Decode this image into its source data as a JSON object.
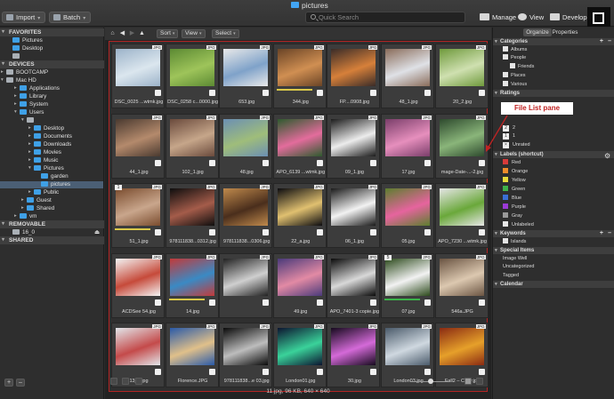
{
  "window": {
    "title": "pictures"
  },
  "toolbar": {
    "import_label": "Import",
    "batch_label": "Batch",
    "search_placeholder": "Quick Search",
    "modes": [
      "Manage",
      "View",
      "Develop"
    ]
  },
  "left_panel": {
    "favorites_header": "FAVORITES",
    "favorites": [
      "Pictures",
      "Desktop"
    ],
    "devices_header": "DEVICES",
    "devices": [
      "BOOTCAMP",
      "Mac HD"
    ],
    "mac_hd_children": [
      "Applications",
      "Library",
      "System",
      "Users"
    ],
    "user_children": [
      "Desktop",
      "Documents",
      "Downloads",
      "Movies",
      "Music",
      "Pictures"
    ],
    "pictures_children": [
      "garden",
      "pictures"
    ],
    "after_pictures": [
      "Public",
      "Guest",
      "Shared",
      "vm"
    ],
    "removable_header": "REMOVABLE",
    "removable_item": "16_0",
    "shared_header": "SHARED"
  },
  "center": {
    "toolbar": {
      "sort_label": "Sort",
      "view_label": "View",
      "select_label": "Select"
    },
    "files": [
      {
        "name": "DSC_0025 ...wtmk.jpg",
        "type": "JPG"
      },
      {
        "name": "DSC_0258 c...0000.jpg",
        "type": "JPG"
      },
      {
        "name": "653.jpg",
        "type": "JPG"
      },
      {
        "name": "344.jpg",
        "type": "JPG"
      },
      {
        "name": "FP....0908.jpg",
        "type": "JPG"
      },
      {
        "name": "48_1.jpg",
        "type": "JPG"
      },
      {
        "name": "20_2.jpg",
        "type": "JPG"
      },
      {
        "name": "44_1.jpg",
        "type": "JPG"
      },
      {
        "name": "102_1.jpg",
        "type": "JPG"
      },
      {
        "name": "48.jpg",
        "type": "JPG"
      },
      {
        "name": "APO_6139 ...wtmk.jpg",
        "type": "JPG"
      },
      {
        "name": "09_1.jpg",
        "type": "JPG"
      },
      {
        "name": "17.jpg",
        "type": "JPG"
      },
      {
        "name": "mage-Date-...-2.jpg",
        "type": "JPG"
      },
      {
        "name": "51_1.jpg",
        "type": "JPG"
      },
      {
        "name": "978111838...0312.jpg",
        "type": "JPG"
      },
      {
        "name": "978111838...0306.jpg",
        "type": "JPG"
      },
      {
        "name": "22_a.jpg",
        "type": "JPG"
      },
      {
        "name": "06_1.jpg",
        "type": "JPG"
      },
      {
        "name": "05.jpg",
        "type": "JPG"
      },
      {
        "name": "APO_7230 ...wtmk.jpg",
        "type": "JPG"
      },
      {
        "name": "ACDSee 54.jpg",
        "type": "JPG"
      },
      {
        "name": "14.jpg",
        "type": "JPG"
      },
      {
        "name": "",
        "type": "JPG"
      },
      {
        "name": "49.jpg",
        "type": "JPG"
      },
      {
        "name": "APO_7401-3 copie.jpg",
        "type": "JPG"
      },
      {
        "name": "07.jpg",
        "type": "JPG"
      },
      {
        "name": "546a.JPG",
        "type": "JPG"
      },
      {
        "name": "13_1.jpg",
        "type": "JPG"
      },
      {
        "name": "Florence.JPG",
        "type": "JPG"
      },
      {
        "name": "978111838...e 03.jpg",
        "type": "JPG"
      },
      {
        "name": "London01.jpg",
        "type": "JPG"
      },
      {
        "name": "30.jpg",
        "type": "JPG"
      },
      {
        "name": "London03.jpg",
        "type": "JPG"
      },
      {
        "name": "Fall2 – Copy.jpg",
        "type": "JPG"
      }
    ],
    "rating_badges": [
      "1",
      "5"
    ],
    "status": "11.jpg, 96 KB, 640 × 640"
  },
  "right_panel": {
    "tabs": [
      "Organize",
      "Properties"
    ],
    "categories_header": "Categories",
    "categories": [
      "Albums",
      "People",
      "Friends",
      "Places",
      "Various"
    ],
    "ratings_header": "Ratings",
    "ratings": [
      "2",
      "1",
      "Unrated"
    ],
    "labels_header": "Labels (shortcut)",
    "labels": [
      {
        "name": "Red",
        "color": "#d63a3a"
      },
      {
        "name": "Orange",
        "color": "#ee8c2a"
      },
      {
        "name": "Yellow",
        "color": "#e8dc3a"
      },
      {
        "name": "Green",
        "color": "#3fb24a"
      },
      {
        "name": "Blue",
        "color": "#3a6fd6"
      },
      {
        "name": "Purple",
        "color": "#9c3ad6"
      },
      {
        "name": "Gray",
        "color": "#9a9a9a"
      },
      {
        "name": "Unlabeled",
        "color": "#e8e8e8"
      }
    ],
    "keywords_header": "Keywords",
    "keywords": [
      "Islands"
    ],
    "special_header": "Special Items",
    "special_items": [
      "Image Well",
      "Uncategorized",
      "Tagged"
    ],
    "calendar_header": "Calendar"
  },
  "annotation": {
    "callout": "File List pane"
  },
  "colors": {
    "accent_blue": "#3fa0e6",
    "callout_red": "#b32424"
  }
}
